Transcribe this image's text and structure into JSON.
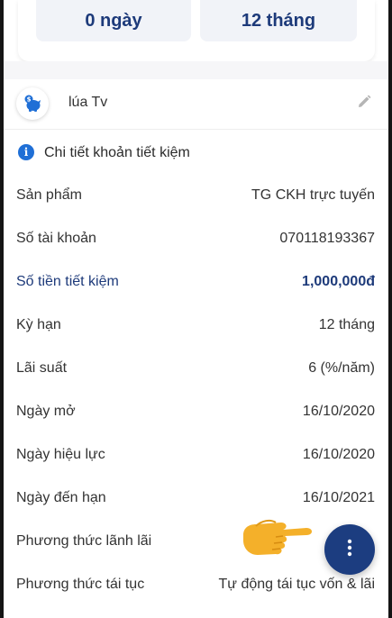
{
  "summary": {
    "left_value": "0 ngày",
    "right_value": "12 tháng"
  },
  "account": {
    "name": "lúa Tv",
    "icon": "piggy-bank-icon",
    "edit_icon": "pencil-icon"
  },
  "details": {
    "title": "Chi tiết khoản tiết kiệm",
    "title_icon": "info-icon",
    "rows": [
      {
        "label": "Sản phẩm",
        "value": "TG CKH trực tuyến"
      },
      {
        "label": "Số tài khoản",
        "value": "070118193367"
      },
      {
        "label": "Số tiền tiết kiệm",
        "value": "1,000,000đ"
      },
      {
        "label": "Kỳ hạn",
        "value": "12 tháng"
      },
      {
        "label": "Lãi suất",
        "value": "6 (%/năm)"
      },
      {
        "label": "Ngày mở",
        "value": "16/10/2020"
      },
      {
        "label": "Ngày hiệu lực",
        "value": "16/10/2020"
      },
      {
        "label": "Ngày đến hạn",
        "value": "16/10/2021"
      },
      {
        "label": "Phương thức lãnh lãi",
        "value": ""
      },
      {
        "label": "Phương thức tái tục",
        "value": "Tự động tái tục vốn & lãi"
      }
    ]
  },
  "fab": {
    "icon": "more-vertical-icon"
  },
  "overlay": {
    "icon": "pointing-hand-icon"
  },
  "colors": {
    "primary": "#1c3d80",
    "accent_blue": "#1f6fd6",
    "stat_bg": "#f1f3f8"
  }
}
